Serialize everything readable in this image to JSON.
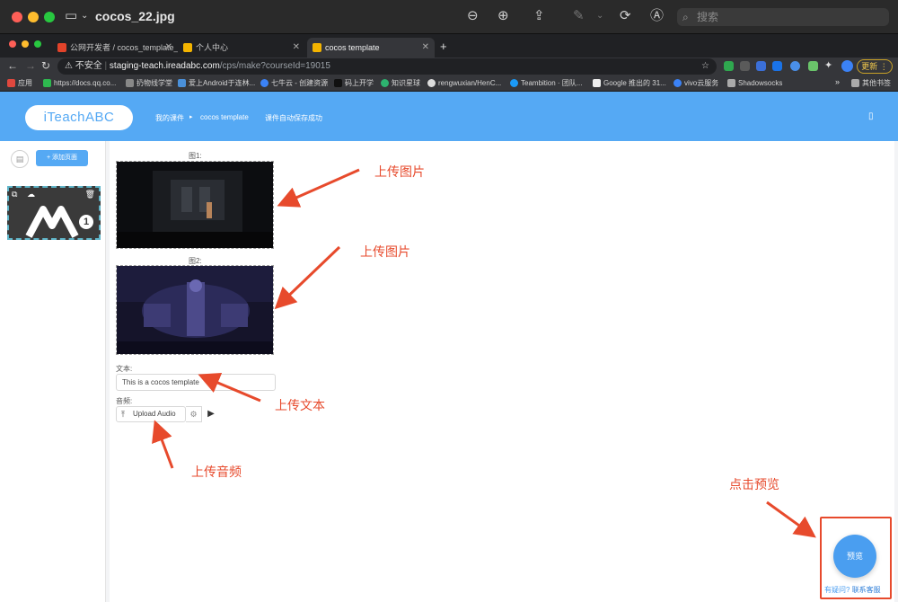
{
  "window": {
    "title": "cocos_22.jpg",
    "search_placeholder": "搜索"
  },
  "tabs": [
    {
      "label": "公网开发者 / cocos_template_...",
      "active": false
    },
    {
      "label": "个人中心",
      "active": false
    },
    {
      "label": "cocos template",
      "active": true
    }
  ],
  "url": {
    "insecure_label": "不安全",
    "host": "staging-teach.ireadabc.com",
    "path": "/cps/make?courseId=19015",
    "update_label": "更新"
  },
  "bookmarks": [
    "应用",
    "https://docs.qq.co...",
    "扔物线学堂",
    "爱上Android于连林...",
    "七牛云 - 创建资源",
    "码上开学",
    "知识星球",
    "rengwuxian/HenC...",
    "Teambition · 团队...",
    "Google 推出的 31...",
    "vivo云服务",
    "Shadowsocks"
  ],
  "bookmarks_other": "其他书签",
  "header": {
    "logo": "iTeachABC",
    "my_courseware": "我的课件",
    "breadcrumb_sep": "▸",
    "course_name": "cocos template",
    "autosave_status": "课件自动保存成功"
  },
  "sidebar": {
    "add_page_label": "+ 添加页面",
    "page_number": "1"
  },
  "form": {
    "image1_label": "图1:",
    "image2_label": "图2:",
    "text_label": "文本:",
    "text_value": "This is a cocos template",
    "audio_label": "音频:",
    "upload_audio_label": "Upload Audio"
  },
  "annotations": {
    "upload_image_1": "上传图片",
    "upload_image_2": "上传图片",
    "upload_text": "上传文本",
    "upload_audio": "上传音频",
    "click_preview": "点击预览"
  },
  "preview": {
    "button_label": "预览",
    "help_question": "有疑问?",
    "contact_support": "联系客服"
  },
  "colors": {
    "accent": "#55a9f4",
    "annotation": "#e74a2c",
    "preview": "#4a9ef0"
  }
}
